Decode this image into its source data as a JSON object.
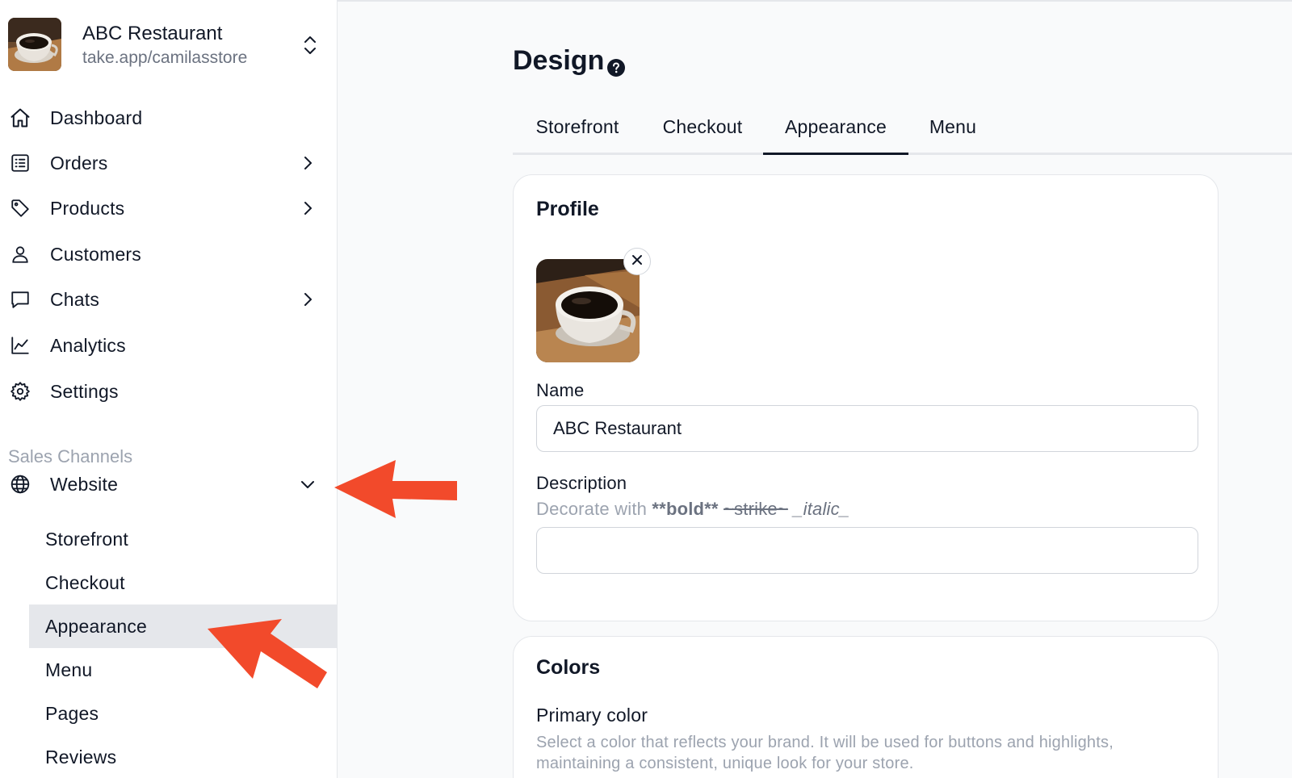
{
  "store": {
    "name": "ABC Restaurant",
    "url": "take.app/camilasstore"
  },
  "sidebar": {
    "items": [
      {
        "label": "Dashboard",
        "icon": "home-icon"
      },
      {
        "label": "Orders",
        "icon": "list-icon"
      },
      {
        "label": "Products",
        "icon": "tag-icon"
      },
      {
        "label": "Customers",
        "icon": "user-icon"
      },
      {
        "label": "Chats",
        "icon": "chat-icon"
      },
      {
        "label": "Analytics",
        "icon": "chart-icon"
      },
      {
        "label": "Settings",
        "icon": "gear-icon"
      }
    ],
    "section_title": "Sales Channels",
    "channel": {
      "label": "Website",
      "icon": "globe-icon"
    },
    "sub_items": [
      {
        "label": "Storefront"
      },
      {
        "label": "Checkout"
      },
      {
        "label": "Appearance",
        "active": true
      },
      {
        "label": "Menu"
      },
      {
        "label": "Pages"
      },
      {
        "label": "Reviews"
      }
    ]
  },
  "main": {
    "title": "Design",
    "tabs": [
      {
        "label": "Storefront"
      },
      {
        "label": "Checkout"
      },
      {
        "label": "Appearance",
        "active": true
      },
      {
        "label": "Menu"
      }
    ],
    "profile": {
      "title": "Profile",
      "name_label": "Name",
      "name_value": "ABC Restaurant",
      "description_label": "Description",
      "description_hint_prefix": "Decorate with ",
      "description_hint_bold": "**bold**",
      "description_hint_strike": "~strike~",
      "description_hint_italic": "_italic_",
      "description_value": ""
    },
    "colors": {
      "title": "Colors",
      "primary_label": "Primary color",
      "primary_hint": "Select a color that reflects your brand. It will be used for buttons and highlights, maintaining a consistent, unique look for your store."
    }
  },
  "colors": {
    "annotation_arrow": "#f24a2b",
    "active_bg": "#e5e7eb",
    "text": "#111827",
    "muted": "#9ca3af"
  }
}
